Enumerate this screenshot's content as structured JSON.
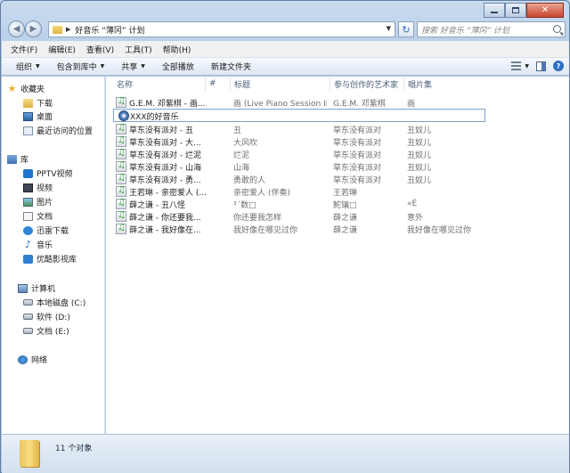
{
  "window": {
    "address_path": "好音乐 “薄冈” 计划",
    "search_placeholder": "搜索 好音乐 “薄冈” 计划"
  },
  "menubar": [
    "文件(F)",
    "编辑(E)",
    "查看(V)",
    "工具(T)",
    "帮助(H)"
  ],
  "toolbar": {
    "organize": "组织",
    "include_in_library": "包含到库中",
    "share": "共享",
    "play_all": "全部播放",
    "new_folder": "新建文件夹"
  },
  "sidebar": {
    "favorites": {
      "label": "收藏夹",
      "items": [
        "下载",
        "桌面",
        "最近访问的位置"
      ]
    },
    "libraries": {
      "label": "库",
      "items": [
        "PPTV视频",
        "视频",
        "图片",
        "文档",
        "迅雷下载",
        "音乐",
        "优酷影视库"
      ]
    },
    "computer": {
      "label": "计算机",
      "items": [
        "本地磁盘 (C:)",
        "软件 (D:)",
        "文档 (E:)"
      ]
    },
    "network": {
      "label": "网络"
    }
  },
  "columns": {
    "name": "名称",
    "number": "#",
    "title": "标题",
    "artist": "参与创作的艺术家",
    "album": "唱片集"
  },
  "files": [
    {
      "name": "G.E.M. 邓紫棋 - 画...",
      "title": "画 (Live Piano Session II)",
      "artist": "G.E.M. 邓紫棋",
      "album": "画",
      "icon": "music-file"
    },
    {
      "name": "XXX的好音乐",
      "title": "",
      "artist": "",
      "album": "",
      "icon": "playlist-file"
    },
    {
      "name": "草东没有派对 - 丑",
      "title": "丑",
      "artist": "草东没有派对",
      "album": "丑奴儿",
      "icon": "music-file"
    },
    {
      "name": "草东没有派对 - 大...",
      "title": "大风吹",
      "artist": "草东没有派对",
      "album": "丑奴儿",
      "icon": "music-file"
    },
    {
      "name": "草东没有派对 - 烂泥",
      "title": "烂泥",
      "artist": "草东没有派对",
      "album": "丑奴儿",
      "icon": "music-file"
    },
    {
      "name": "草东没有派对 - 山海",
      "title": "山海",
      "artist": "草东没有派对",
      "album": "丑奴儿",
      "icon": "music-file"
    },
    {
      "name": "草东没有派对 - 勇...",
      "title": "勇敢的人",
      "artist": "草东没有派对",
      "album": "丑奴儿",
      "icon": "music-file"
    },
    {
      "name": "王若琳 - 亲密爱人 (...",
      "title": "亲密爱人 (伴奏)",
      "artist": "王若琳",
      "album": "",
      "icon": "music-file"
    },
    {
      "name": "薛之谦 - 丑八怪",
      "title": "³´数□",
      "artist": "鮀镶□",
      "album": "«É",
      "icon": "music-file"
    },
    {
      "name": "薛之谦 - 你还要我...",
      "title": "你还要我怎样",
      "artist": "薛之谦",
      "album": "意外",
      "icon": "music-file"
    },
    {
      "name": "薛之谦 - 我好像在...",
      "title": "我好像在哪见过你",
      "artist": "薛之谦",
      "album": "我好像在哪见过你",
      "icon": "music-file"
    }
  ],
  "status": {
    "item_count": "11 个对象"
  }
}
